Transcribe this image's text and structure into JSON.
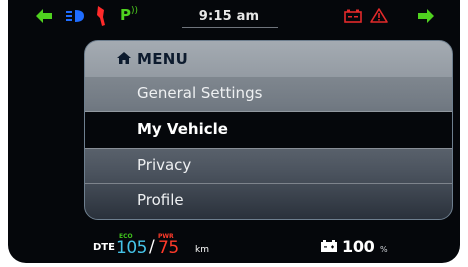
{
  "status_bar": {
    "time": "9:15 am",
    "park_label": "P",
    "icons": [
      "left-turn-signal-icon",
      "headlight-icon",
      "kickstand-icon",
      "park-assist-icon",
      "battery-warning-icon",
      "hazard-warning-icon",
      "right-turn-signal-icon"
    ],
    "colors": {
      "turn_signal": "#4fd11f",
      "headlight": "#1f6dff",
      "kickstand": "#ff2a2a",
      "warning": "#e32a2a",
      "text": "#e8e8e8"
    }
  },
  "menu": {
    "title": "MENU",
    "items": [
      {
        "label": "General Settings",
        "selected": false
      },
      {
        "label": "My Vehicle",
        "selected": true
      },
      {
        "label": "Privacy",
        "selected": false
      },
      {
        "label": "Profile",
        "selected": false
      }
    ]
  },
  "bottom_bar": {
    "dte_label": "DTE",
    "eco_label": "ECO",
    "eco_value": "105",
    "pwr_label": "PWR",
    "pwr_value": "75",
    "unit": "km",
    "battery_value": "100",
    "battery_unit": "%",
    "colors": {
      "eco_value": "#45c3e8",
      "eco_label": "#3fc21c",
      "pwr": "#ff3a2a"
    }
  }
}
